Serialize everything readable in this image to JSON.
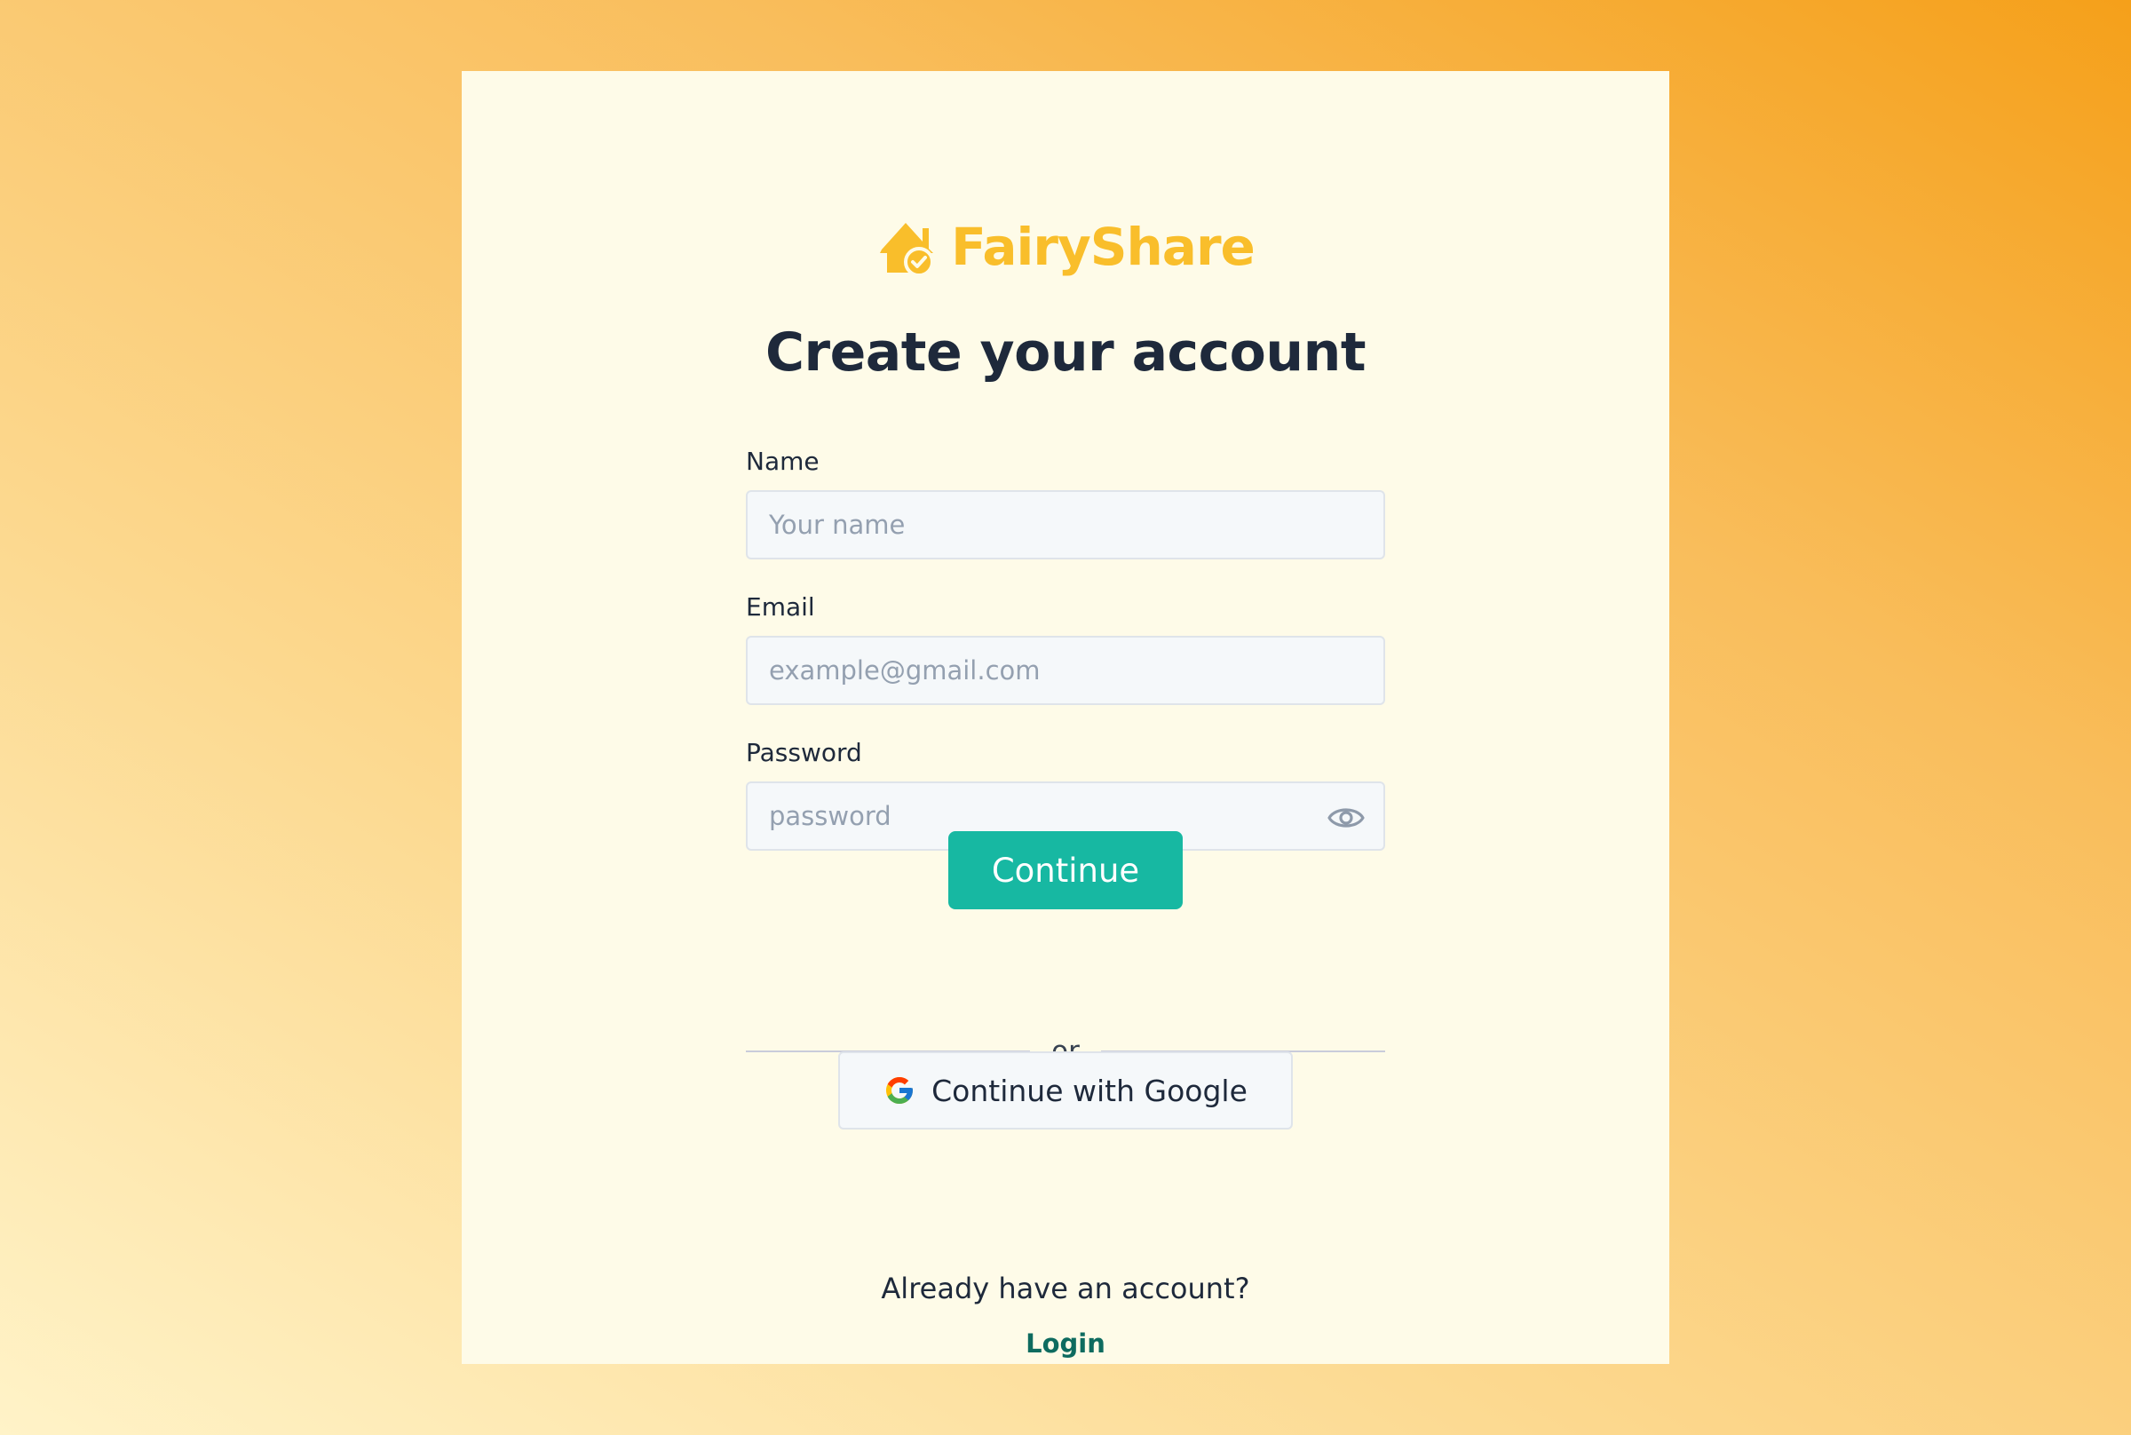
{
  "brand": {
    "name": "FairyShare",
    "logo_icon": "house-check-icon",
    "color": "#f9be2b"
  },
  "page": {
    "title": "Create your account"
  },
  "form": {
    "name": {
      "label": "Name",
      "placeholder": "Your name",
      "value": ""
    },
    "email": {
      "label": "Email",
      "placeholder": "example@gmail.com",
      "value": ""
    },
    "password": {
      "label": "Password",
      "placeholder": "password",
      "value": "",
      "toggle_icon": "eye-icon"
    },
    "continue_label": "Continue"
  },
  "divider": {
    "text": "or"
  },
  "google": {
    "label": "Continue with Google",
    "icon": "google-icon"
  },
  "footer": {
    "prompt": "Already have an account?",
    "login_label": "Login"
  },
  "colors": {
    "accent": "#17b8a2",
    "link": "#0e6b5f",
    "card_bg": "#fefbe8"
  }
}
